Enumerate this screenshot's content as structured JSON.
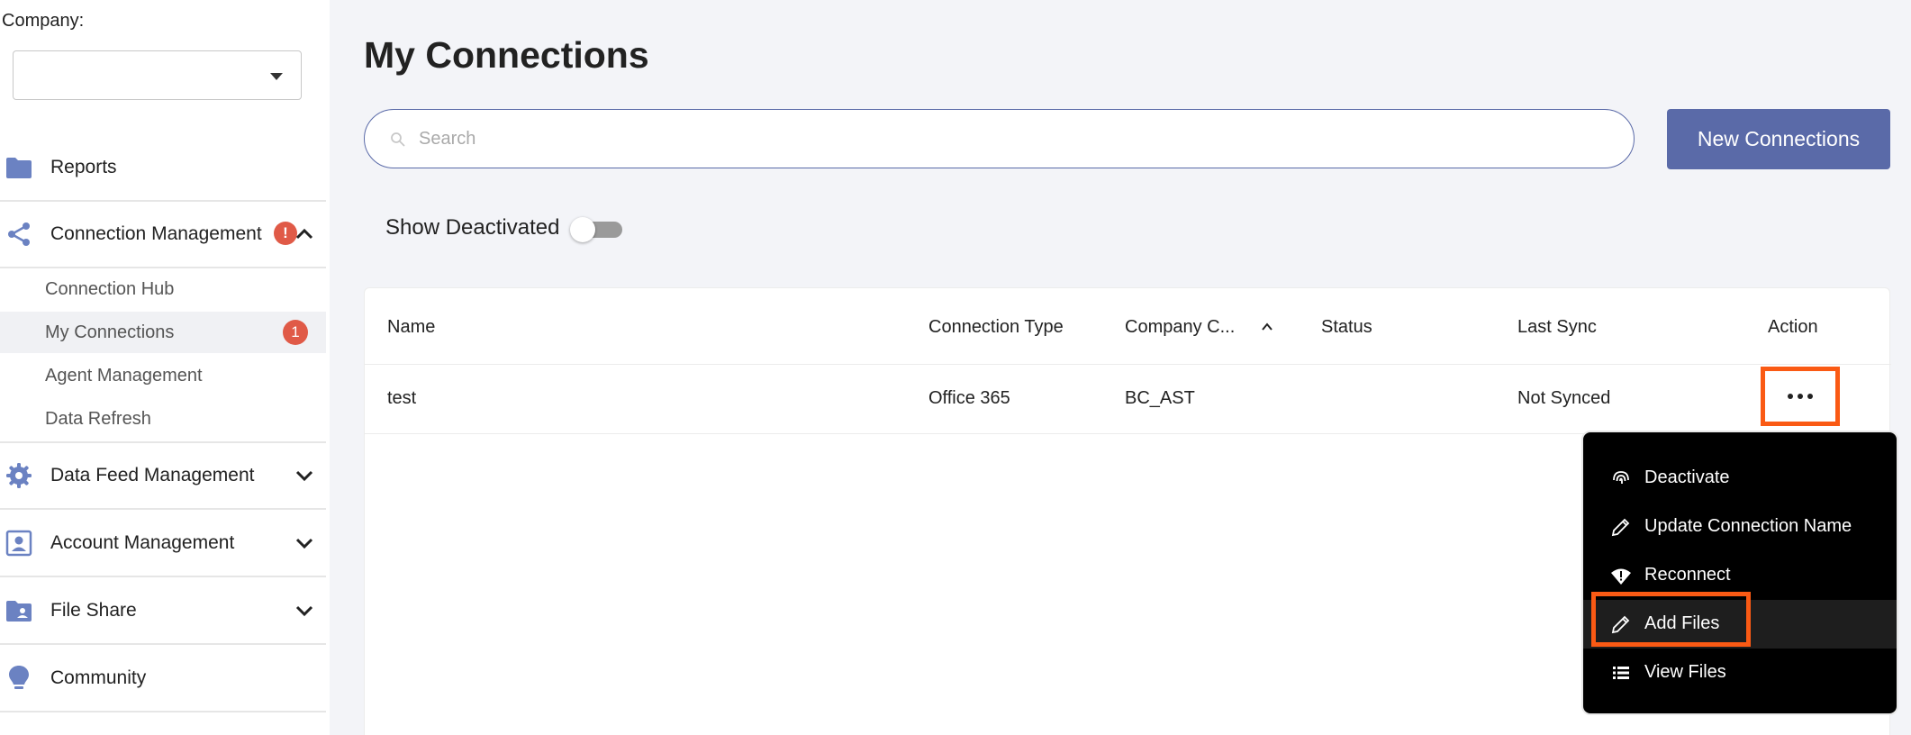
{
  "sidebar": {
    "company_label": "Company:",
    "company_value": "",
    "items": [
      {
        "label": "Reports",
        "icon": "folder-icon"
      },
      {
        "label": "Connection Management",
        "icon": "share-icon",
        "alert": "!"
      },
      {
        "label": "Data Feed Management",
        "icon": "gear-icon"
      },
      {
        "label": "Account Management",
        "icon": "account-icon"
      },
      {
        "label": "File Share",
        "icon": "folder-user-icon"
      },
      {
        "label": "Community",
        "icon": "lightbulb-icon"
      }
    ],
    "sub_items": [
      {
        "label": "Connection Hub"
      },
      {
        "label": "My Connections",
        "badge": "1"
      },
      {
        "label": "Agent Management"
      },
      {
        "label": "Data Refresh"
      }
    ]
  },
  "main": {
    "title": "My Connections",
    "search_placeholder": "Search",
    "new_button": "New Connections",
    "show_deactivated_label": "Show Deactivated"
  },
  "table": {
    "headers": [
      "Name",
      "Connection Type",
      "Company C...",
      "Status",
      "Last Sync",
      "Action"
    ],
    "rows": [
      {
        "name": "test",
        "type": "Office 365",
        "company": "BC_AST",
        "status": "",
        "last_sync": "Not Synced"
      }
    ]
  },
  "menu": {
    "items": [
      {
        "label": "Deactivate",
        "icon": "fingerprint-icon"
      },
      {
        "label": "Update Connection Name",
        "icon": "pencil-icon"
      },
      {
        "label": "Reconnect",
        "icon": "wifi-alert-icon"
      },
      {
        "label": "Add Files",
        "icon": "pencil-icon"
      },
      {
        "label": "View Files",
        "icon": "list-icon"
      }
    ]
  },
  "colors": {
    "accent": "#5a6aa8",
    "badge": "#e05a47",
    "highlight": "#fa5a14",
    "icon_blue": "#6b82c2"
  }
}
